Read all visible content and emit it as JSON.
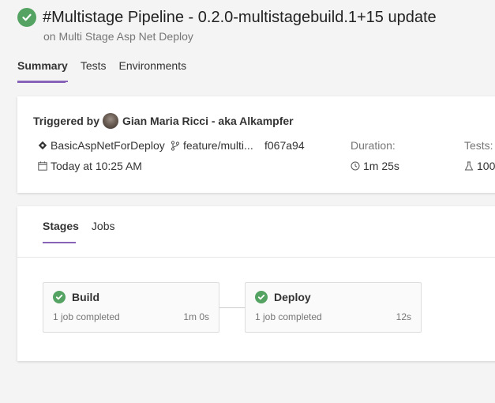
{
  "header": {
    "title": "#Multistage Pipeline - 0.2.0-multistagebuild.1+15 update",
    "subtitle": "on Multi Stage Asp Net Deploy",
    "status_icon": "success-check-icon",
    "status_color": "#55a362"
  },
  "tabs": [
    {
      "label": "Summary",
      "active": true
    },
    {
      "label": "Tests",
      "active": false
    },
    {
      "label": "Environments",
      "active": false
    }
  ],
  "summary": {
    "triggered_label": "Triggered by",
    "user": "Gian Maria Ricci - aka Alkampfer",
    "repo": "BasicAspNetForDeploy",
    "branch": "feature/multi...",
    "commit": "f067a94",
    "date": "Today at 10:25 AM",
    "duration_label": "Duration:",
    "duration": "1m 25s",
    "tests_label": "Tests:",
    "tests": "100"
  },
  "stage_tabs": [
    {
      "label": "Stages",
      "active": true
    },
    {
      "label": "Jobs",
      "active": false
    }
  ],
  "stages": [
    {
      "name": "Build",
      "status": "1 job completed",
      "time": "1m 0s"
    },
    {
      "name": "Deploy",
      "status": "1 job completed",
      "time": "12s"
    }
  ],
  "accent_color": "#8764b8"
}
